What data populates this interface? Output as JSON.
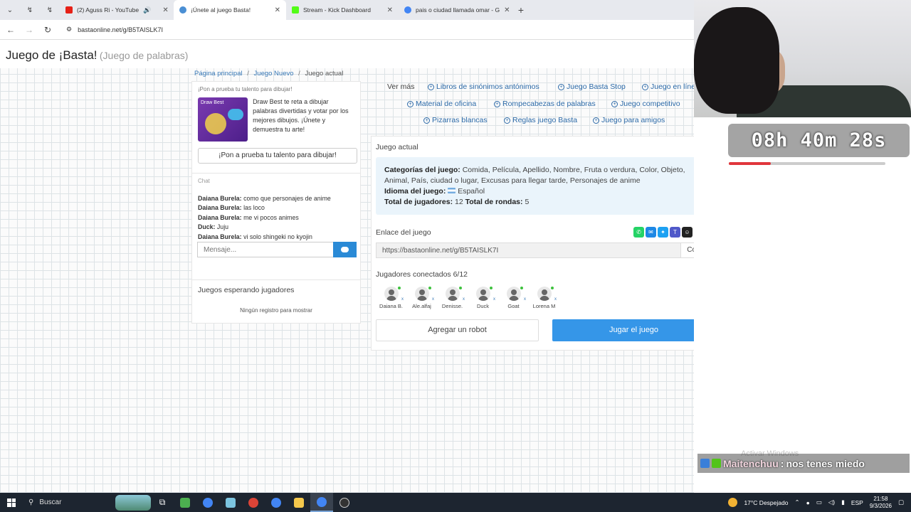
{
  "browser": {
    "tabs": [
      {
        "label": "",
        "color": "#6a6a6a"
      },
      {
        "label": "(2) Aguss Ri - YouTube",
        "color": "#e62117",
        "audio": "🔊"
      },
      {
        "label": "¡Únete al juego Basta!",
        "color": "#4a8fd4",
        "active": true
      },
      {
        "label": "Stream - Kick Dashboard",
        "color": "#53fc18"
      },
      {
        "label": "pais o ciudad llamada omar - G",
        "color": "#4285f4"
      }
    ],
    "url": "bastaonline.net/g/B5TAISLK7I",
    "close_glyph": "✕",
    "newtab_glyph": "+"
  },
  "site": {
    "title": "Juego de ¡Basta!",
    "subtitle": "(Juego de palabras)"
  },
  "breadcrumb": {
    "home": "Página principal",
    "new": "Juego Nuevo",
    "current": "Juego actual",
    "sep": "/"
  },
  "ad": {
    "header": "¡Pon a prueba tu talento para dibujar!",
    "img_label": "Draw Best",
    "text": "Draw Best te reta a dibujar palabras divertidas y votar por los mejores dibujos. ¡Únete y demuestra tu arte!",
    "button": "¡Pon a prueba tu talento para dibujar!"
  },
  "chat": {
    "title": "Chat",
    "messages": [
      {
        "user": "Daiana Burela:",
        "text": "como que personajes de anime"
      },
      {
        "user": "Daiana Burela:",
        "text": "las loco"
      },
      {
        "user": "Daiana Burela:",
        "text": "me vi pocos animes"
      },
      {
        "user": "Duck:",
        "text": "Juju"
      },
      {
        "user": "Daiana Burela:",
        "text": "vi solo shingeki no kyojin"
      }
    ],
    "placeholder": "Mensaje..."
  },
  "waiting": {
    "title": "Juegos esperando jugadores",
    "empty": "Ningún registro para mostrar"
  },
  "more_links": {
    "label": "Ver más",
    "plus_glyph": "+",
    "links": [
      "Libros de sinónimos antónimos",
      "Juego Basta Stop",
      "Juego en línea",
      "Material de oficina",
      "Rompecabezas de palabras",
      "Juego competitivo",
      "Pizarras blancas",
      "Reglas juego Basta",
      "Juego para amigos"
    ]
  },
  "game": {
    "title": "Juego actual",
    "categories_label": "Categorías del juego:",
    "categories": "Comida, Película, Apellido, Nombre, Fruta o verdura, Color, Objeto, Animal, País, ciudad o lugar, Excusas para llegar tarde, Personajes de anime",
    "language_label": "Idioma del juego:",
    "language": "Español",
    "players_label": "Total de jugadores:",
    "players": "12",
    "rounds_label": "Total de rondas:",
    "rounds": "5",
    "link_label": "Enlace del juego",
    "link": "https://bastaonline.net/g/B5TAISLK7I",
    "copy": "Copiar",
    "connected_label": "Jugadores conectados 6/12",
    "connected": [
      "Daiana B.",
      "Ale.alfaj",
      "Denisse.",
      "Duck",
      "Goat",
      "Lorena M"
    ],
    "remove_glyph": "x",
    "robot_button": "Agregar un robot",
    "play_button": "Jugar el juego"
  },
  "share": [
    {
      "name": "whatsapp-icon",
      "color": "#25d366",
      "glyph": "✆"
    },
    {
      "name": "messenger-icon",
      "color": "#1e88e5",
      "glyph": "✉"
    },
    {
      "name": "twitter-icon",
      "color": "#1da1f2",
      "glyph": "✦"
    },
    {
      "name": "teams-icon",
      "color": "#5059c9",
      "glyph": "T"
    },
    {
      "name": "snapchat-icon",
      "color": "#222222",
      "glyph": "☺"
    },
    {
      "name": "share-more-icon",
      "color": "#0b6bd6",
      "glyph": "+"
    }
  ],
  "stream": {
    "timer": "08h 40m 28s",
    "timer_progress": 0.27,
    "chat_user": "Maitenchuu",
    "chat_sep": ":",
    "chat_text": "nos tenes miedo",
    "watermark": "Activar Windows"
  },
  "taskbar": {
    "search": "Buscar",
    "weather": "17°C  Despejado",
    "lang": "ESP",
    "time": "21:58",
    "date": "9/3/2026",
    "apps": [
      "#4caf50",
      "#4285f4",
      "#7cc4e0",
      "#db4437",
      "#4285f4",
      "#f5c84c",
      "#4285f4",
      "#333333"
    ]
  },
  "colors": {
    "accent": "#3596e8",
    "link": "#2c6aa8",
    "info_bg": "#eaf4fb"
  }
}
